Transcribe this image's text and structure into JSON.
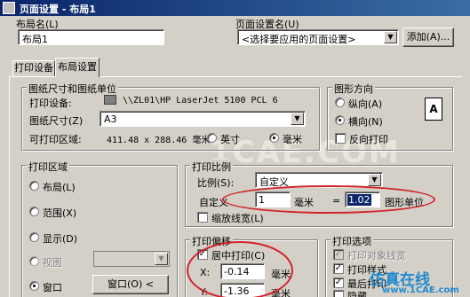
{
  "window": {
    "title": "页面设置 - 布局1"
  },
  "layout_name": {
    "label": "布局名(L)",
    "value": "布局1"
  },
  "page_setup": {
    "label": "页面设置名(U)",
    "value": "<选择要应用的页面设置>",
    "add_button": "添加(A)..."
  },
  "tabs": [
    {
      "label": "打印设备"
    },
    {
      "label": "布局设置"
    }
  ],
  "paper": {
    "group_title": "图纸尺寸和图纸单位",
    "device_label": "打印设备:",
    "device_value": "\\\\ZL01\\HP LaserJet 5100 PCL 6",
    "size_label": "图纸尺寸(Z)",
    "size_value": "A3",
    "area_label": "可打印区域:",
    "area_value": "411.48 x 288.46 毫米",
    "unit_inch": "英寸",
    "unit_mm": "毫米",
    "selected_unit": "毫米"
  },
  "orientation": {
    "group_title": "图形方向",
    "portrait": "纵向(A)",
    "landscape": "横向(N)",
    "reverse": "反向打印",
    "selected": "横向(N)",
    "reverse_checked": false
  },
  "print_area": {
    "group_title": "打印区域",
    "layout": "布局(L)",
    "extents": "范围(X)",
    "display": "显示(D)",
    "view": "视图",
    "window": "窗口",
    "window_button": "窗口(O) <",
    "selected": "窗口"
  },
  "scale": {
    "group_title": "打印比例",
    "ratio_label": "比例(S):",
    "ratio_value": "自定义",
    "custom_label": "自定义",
    "mm_value": "1",
    "mm_unit": "毫米",
    "equals": "=",
    "units_value": "1.02",
    "units_label": "图形单位",
    "lineweight": "缩放线宽(L)",
    "lineweight_checked": false
  },
  "offset": {
    "group_title": "打印偏移",
    "center": "居中打印(C)",
    "center_checked": true,
    "x_label": "X:",
    "x_value": "-0.14",
    "y_label": "Y:",
    "y_value": "-1.36",
    "unit": "毫米"
  },
  "options": {
    "group_title": "打印选项",
    "obj_lw": "打印对象线宽",
    "styles": "打印样式",
    "last_paper": "最后打印",
    "hide": "隐藏"
  },
  "watermark": {
    "text": "1CAE.COM",
    "brand": "仿真在线",
    "url": "www.1CAE.com"
  },
  "colors": {
    "title_start": "#0a246a",
    "title_end": "#3a6ea5",
    "face": "#d4d0c8",
    "highlight": "#0a246a",
    "annotation": "#d2232a"
  }
}
